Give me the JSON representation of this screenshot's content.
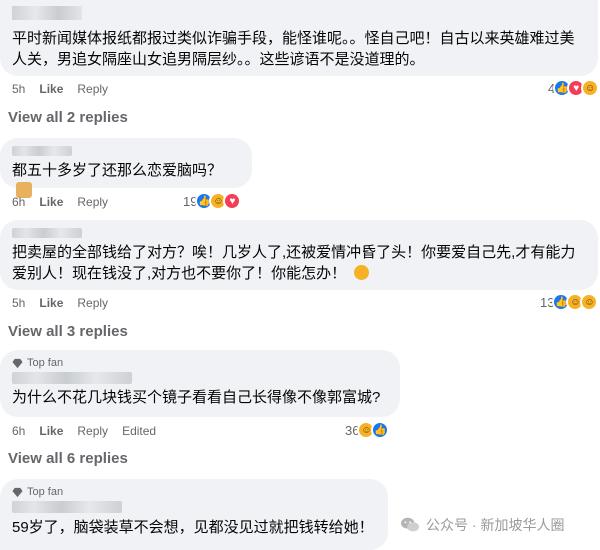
{
  "comments": [
    {
      "text": "平时新闻媒体报纸都报过类似诈骗手段，能怪谁呢。。怪自己吧！自古以来英雄难过美人关，男追女隔座山女追男隔层纱。。这些谚语不是没道理的。",
      "time": "5h",
      "like": "Like",
      "reply": "Reply",
      "reaction_count": "4"
    },
    {
      "text": "都五十多岁了还那么恋爱脑吗？",
      "time": "6h",
      "like": "Like",
      "reply": "Reply",
      "reaction_count": "19"
    },
    {
      "text": "把卖屋的全部钱给了对方？唉！几岁人了,还被爱情冲昏了头！你要爱自己先,才有能力爱别人！现在钱没了,对方也不要你了！你能怎办！",
      "time": "5h",
      "like": "Like",
      "reply": "Reply",
      "reaction_count": "13"
    },
    {
      "badge": "Top fan",
      "text": "为什么不花几块钱买个镜子看看自己长得像不像郭富城?",
      "time": "6h",
      "like": "Like",
      "reply": "Reply",
      "edited": "Edited",
      "reaction_count": "36"
    },
    {
      "badge": "Top fan",
      "text": "59岁了，脑袋装草不会想，见都没见过就把钱转给她！"
    }
  ],
  "view_replies": [
    "View all 2 replies",
    "View all 3 replies",
    "View all 6 replies"
  ],
  "watermark": "公众号 · 新加坡华人圈",
  "colors": {
    "like": "#1877f2",
    "love": "#f33e58",
    "haha": "#f7b125",
    "bubble": "#f0f2f5",
    "meta": "#65676b"
  },
  "icons": [
    "like-reaction-icon",
    "love-reaction-icon",
    "haha-reaction-icon",
    "diamond-badge-icon",
    "wechat-icon",
    "facepalm-emoji-icon",
    "laugh-emoji-icon"
  ]
}
